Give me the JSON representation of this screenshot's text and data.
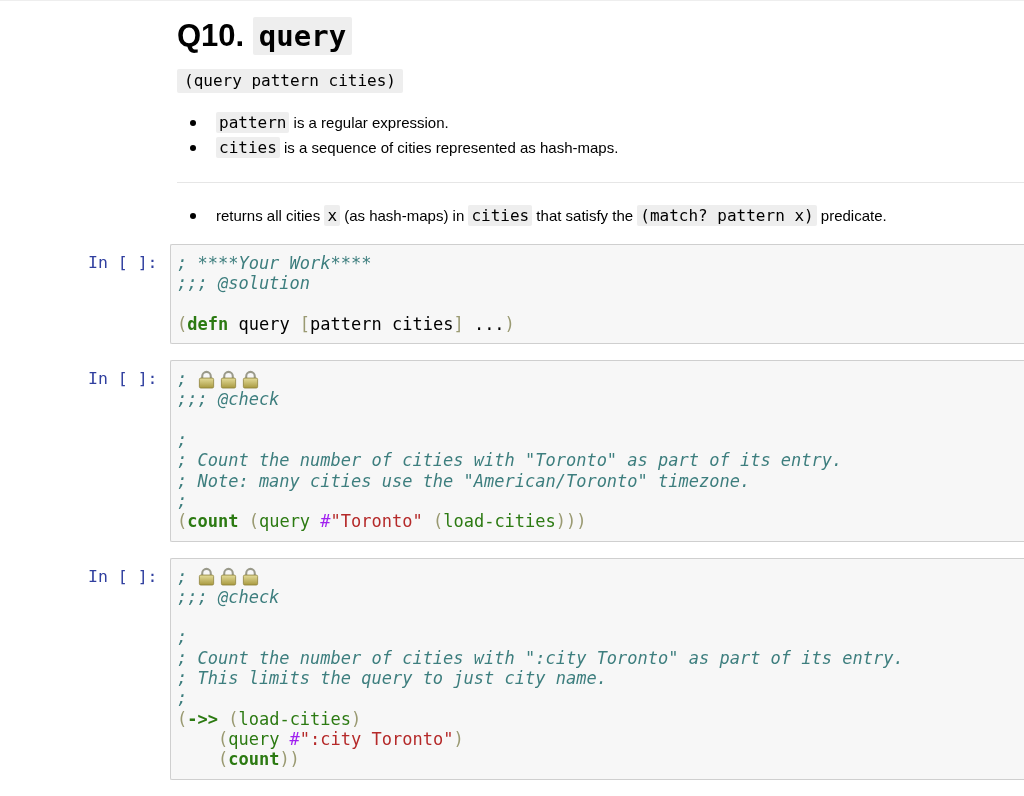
{
  "heading": {
    "text": "Q10. ",
    "code": "query"
  },
  "signature": "(query pattern cities)",
  "params": [
    {
      "parts": [
        {
          "kind": "code",
          "text": "pattern"
        },
        {
          "kind": "text",
          "text": " is a regular expression."
        }
      ]
    },
    {
      "parts": [
        {
          "kind": "code",
          "text": "cities"
        },
        {
          "kind": "text",
          "text": " is a sequence of cities represented as hash-maps."
        }
      ]
    }
  ],
  "returns": [
    {
      "parts": [
        {
          "kind": "text",
          "text": "returns all cities "
        },
        {
          "kind": "code",
          "text": "x"
        },
        {
          "kind": "text",
          "text": " (as hash-maps) in "
        },
        {
          "kind": "code",
          "text": "cities"
        },
        {
          "kind": "text",
          "text": " that satisfy the "
        },
        {
          "kind": "code",
          "text": "(match? pattern x)"
        },
        {
          "kind": "text",
          "text": " predicate."
        }
      ]
    }
  ],
  "cells": [
    {
      "prompt": "In [ ]:",
      "lines": [
        {
          "tokens": [
            {
              "kind": "comment",
              "text": "; ****Your Work****"
            }
          ]
        },
        {
          "tokens": [
            {
              "kind": "comment",
              "text": ";;; @solution"
            }
          ]
        },
        {
          "kind": "blank"
        },
        {
          "tokens": [
            {
              "kind": "bracket",
              "text": "("
            },
            {
              "kind": "keyword",
              "text": "defn"
            },
            {
              "kind": "plain",
              "text": " query "
            },
            {
              "kind": "bracket",
              "text": "["
            },
            {
              "kind": "plain",
              "text": "pattern cities"
            },
            {
              "kind": "bracket",
              "text": "]"
            },
            {
              "kind": "plain",
              "text": " ..."
            },
            {
              "kind": "bracket",
              "text": ")"
            }
          ]
        }
      ]
    },
    {
      "prompt": "In [ ]:",
      "lines": [
        {
          "tokens": [
            {
              "kind": "comment",
              "text": "; "
            },
            {
              "kind": "lock"
            },
            {
              "kind": "lock"
            },
            {
              "kind": "lock"
            }
          ]
        },
        {
          "tokens": [
            {
              "kind": "comment",
              "text": ";;; @check"
            }
          ]
        },
        {
          "kind": "blank"
        },
        {
          "tokens": [
            {
              "kind": "comment",
              "text": ";"
            }
          ]
        },
        {
          "tokens": [
            {
              "kind": "comment",
              "text": "; Count the number of cities with \"Toronto\" as part of its entry."
            }
          ]
        },
        {
          "tokens": [
            {
              "kind": "comment",
              "text": "; Note: many cities use the \"American/Toronto\" timezone."
            }
          ]
        },
        {
          "tokens": [
            {
              "kind": "comment",
              "text": ";"
            }
          ]
        },
        {
          "tokens": [
            {
              "kind": "bracket",
              "text": "("
            },
            {
              "kind": "keyword",
              "text": "count"
            },
            {
              "kind": "bracket",
              "text": " ("
            },
            {
              "kind": "function",
              "text": "query"
            },
            {
              "kind": "hash",
              "text": " #"
            },
            {
              "kind": "string",
              "text": "\"Toronto\""
            },
            {
              "kind": "bracket",
              "text": " ("
            },
            {
              "kind": "function",
              "text": "load-cities"
            },
            {
              "kind": "bracket",
              "text": ")))"
            }
          ]
        }
      ]
    },
    {
      "prompt": "In [ ]:",
      "lines": [
        {
          "tokens": [
            {
              "kind": "comment",
              "text": "; "
            },
            {
              "kind": "lock"
            },
            {
              "kind": "lock"
            },
            {
              "kind": "lock"
            }
          ]
        },
        {
          "tokens": [
            {
              "kind": "comment",
              "text": ";;; @check"
            }
          ]
        },
        {
          "kind": "blank"
        },
        {
          "tokens": [
            {
              "kind": "comment",
              "text": ";"
            }
          ]
        },
        {
          "tokens": [
            {
              "kind": "comment",
              "text": "; Count the number of cities with \":city Toronto\" as part of its entry."
            }
          ]
        },
        {
          "tokens": [
            {
              "kind": "comment",
              "text": "; This limits the query to just city name."
            }
          ]
        },
        {
          "tokens": [
            {
              "kind": "comment",
              "text": ";"
            }
          ]
        },
        {
          "tokens": [
            {
              "kind": "bracket",
              "text": "("
            },
            {
              "kind": "keyword",
              "text": "->>"
            },
            {
              "kind": "bracket",
              "text": " ("
            },
            {
              "kind": "function",
              "text": "load-cities"
            },
            {
              "kind": "bracket",
              "text": ")"
            }
          ]
        },
        {
          "tokens": [
            {
              "kind": "bracket",
              "text": "    ("
            },
            {
              "kind": "function",
              "text": "query"
            },
            {
              "kind": "hash",
              "text": " #"
            },
            {
              "kind": "string",
              "text": "\":city Toronto\""
            },
            {
              "kind": "bracket",
              "text": ")"
            }
          ]
        },
        {
          "tokens": [
            {
              "kind": "bracket",
              "text": "    ("
            },
            {
              "kind": "keyword",
              "text": "count"
            },
            {
              "kind": "bracket",
              "text": "))"
            }
          ]
        }
      ]
    }
  ]
}
